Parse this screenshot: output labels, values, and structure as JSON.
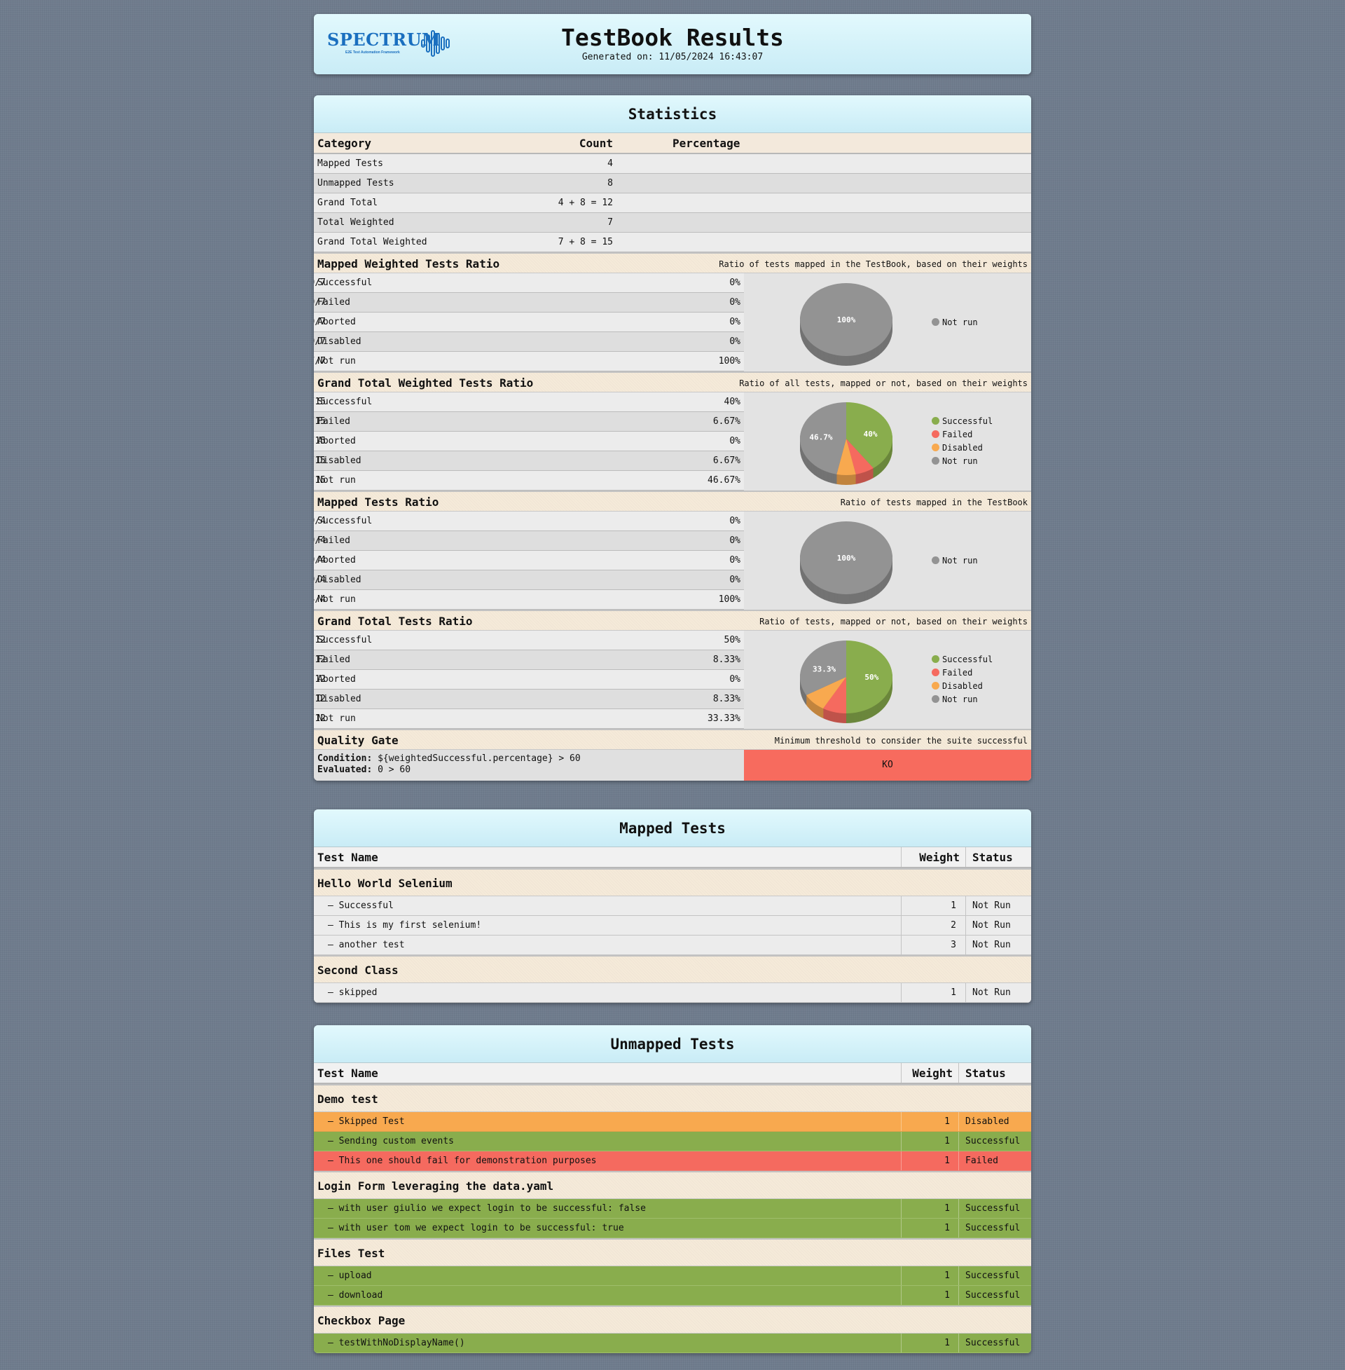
{
  "header": {
    "logo": "SPECTRUM",
    "logo_sub": "E2E Test Automation Framework",
    "title": "TestBook Results",
    "generated": "Generated on: 11/05/2024 16:43:07"
  },
  "statistics": {
    "title": "Statistics",
    "columns": [
      "Category",
      "Count",
      "Percentage"
    ],
    "summary": [
      {
        "category": "Mapped Tests",
        "count": "4"
      },
      {
        "category": "Unmapped Tests",
        "count": "8"
      },
      {
        "category": "Grand Total",
        "count": "4 + 8 = 12"
      },
      {
        "category": "Total Weighted",
        "count": "7"
      },
      {
        "category": "Grand Total Weighted",
        "count": "7 + 8 = 15"
      }
    ],
    "ratios": [
      {
        "title": "Mapped Weighted Tests Ratio",
        "desc": "Ratio of tests mapped in the TestBook, based on their weights",
        "rows": [
          {
            "label": "Successful",
            "count": "0/7",
            "pct": "0%"
          },
          {
            "label": "Failed",
            "count": "0/7",
            "pct": "0%"
          },
          {
            "label": "Aborted",
            "count": "0/7",
            "pct": "0%"
          },
          {
            "label": "Disabled",
            "count": "0/7",
            "pct": "0%"
          },
          {
            "label": "Not run",
            "count": "7/7",
            "pct": "100%"
          }
        ],
        "slices": [
          {
            "name": "Not run",
            "value": 100,
            "color": "#939393",
            "label": "100%"
          }
        ],
        "legend": [
          "Not run"
        ]
      },
      {
        "title": "Grand Total Weighted Tests Ratio",
        "desc": "Ratio of all tests, mapped or not, based on their weights",
        "rows": [
          {
            "label": "Successful",
            "count": "6/15",
            "pct": "40%"
          },
          {
            "label": "Failed",
            "count": "1/15",
            "pct": "6.67%"
          },
          {
            "label": "Aborted",
            "count": "0/15",
            "pct": "0%"
          },
          {
            "label": "Disabled",
            "count": "1/15",
            "pct": "6.67%"
          },
          {
            "label": "Not run",
            "count": "7/15",
            "pct": "46.67%"
          }
        ],
        "slices": [
          {
            "name": "Successful",
            "value": 40,
            "color": "#89ad4d",
            "label": "40%"
          },
          {
            "name": "Failed",
            "value": 6.67,
            "color": "#f56a5f",
            "label": ""
          },
          {
            "name": "Disabled",
            "value": 6.67,
            "color": "#f8a94f",
            "label": ""
          },
          {
            "name": "Not run",
            "value": 46.67,
            "color": "#939393",
            "label": "46.7%"
          }
        ],
        "legend": [
          "Successful",
          "Failed",
          "Disabled",
          "Not run"
        ]
      },
      {
        "title": "Mapped Tests Ratio",
        "desc": "Ratio of tests mapped in the TestBook",
        "rows": [
          {
            "label": "Successful",
            "count": "0/4",
            "pct": "0%"
          },
          {
            "label": "Failed",
            "count": "0/4",
            "pct": "0%"
          },
          {
            "label": "Aborted",
            "count": "0/4",
            "pct": "0%"
          },
          {
            "label": "Disabled",
            "count": "0/4",
            "pct": "0%"
          },
          {
            "label": "Not run",
            "count": "4/4",
            "pct": "100%"
          }
        ],
        "slices": [
          {
            "name": "Not run",
            "value": 100,
            "color": "#939393",
            "label": "100%"
          }
        ],
        "legend": [
          "Not run"
        ]
      },
      {
        "title": "Grand Total Tests Ratio",
        "desc": "Ratio of tests, mapped or not, based on their weights",
        "rows": [
          {
            "label": "Successful",
            "count": "6/12",
            "pct": "50%"
          },
          {
            "label": "Failed",
            "count": "1/12",
            "pct": "8.33%"
          },
          {
            "label": "Aborted",
            "count": "0/12",
            "pct": "0%"
          },
          {
            "label": "Disabled",
            "count": "1/12",
            "pct": "8.33%"
          },
          {
            "label": "Not run",
            "count": "4/12",
            "pct": "33.33%"
          }
        ],
        "slices": [
          {
            "name": "Successful",
            "value": 50,
            "color": "#89ad4d",
            "label": "50%"
          },
          {
            "name": "Failed",
            "value": 8.33,
            "color": "#f56a5f",
            "label": ""
          },
          {
            "name": "Disabled",
            "value": 8.33,
            "color": "#f8a94f",
            "label": ""
          },
          {
            "name": "Not run",
            "value": 33.33,
            "color": "#939393",
            "label": "33.3%"
          }
        ],
        "legend": [
          "Successful",
          "Failed",
          "Disabled",
          "Not run"
        ]
      }
    ],
    "legend_colors": {
      "Successful": "#89ad4d",
      "Failed": "#f56a5f",
      "Disabled": "#f8a94f",
      "Not run": "#939393"
    },
    "quality_gate": {
      "title": "Quality Gate",
      "desc": "Minimum threshold to consider the suite successful",
      "condition_label": "Condition:",
      "condition": "${weightedSuccessful.percentage} > 60",
      "evaluated_label": "Evaluated:",
      "evaluated": "0 > 60",
      "result": "KO"
    }
  },
  "mapped": {
    "title": "Mapped Tests",
    "columns": [
      "Test Name",
      "Weight",
      "Status"
    ],
    "groups": [
      {
        "name": "Hello World Selenium",
        "tests": [
          {
            "name": "– Successful",
            "weight": "1",
            "status": "Not Run"
          },
          {
            "name": "– This is my first selenium!",
            "weight": "2",
            "status": "Not Run"
          },
          {
            "name": "– another test",
            "weight": "3",
            "status": "Not Run"
          }
        ]
      },
      {
        "name": "Second Class",
        "tests": [
          {
            "name": "– skipped",
            "weight": "1",
            "status": "Not Run"
          }
        ]
      }
    ]
  },
  "unmapped": {
    "title": "Unmapped Tests",
    "columns": [
      "Test Name",
      "Weight",
      "Status"
    ],
    "groups": [
      {
        "name": "Demo test",
        "tests": [
          {
            "name": "– Skipped Test",
            "weight": "1",
            "status": "Disabled"
          },
          {
            "name": "– Sending custom events",
            "weight": "1",
            "status": "Successful"
          },
          {
            "name": "– This one should fail for demonstration purposes",
            "weight": "1",
            "status": "Failed"
          }
        ]
      },
      {
        "name": "Login Form leveraging the data.yaml",
        "tests": [
          {
            "name": "– with user giulio we expect login to be successful: false",
            "weight": "1",
            "status": "Successful"
          },
          {
            "name": "– with user tom we expect login to be successful: true",
            "weight": "1",
            "status": "Successful"
          }
        ]
      },
      {
        "name": "Files Test",
        "tests": [
          {
            "name": "– upload",
            "weight": "1",
            "status": "Successful"
          },
          {
            "name": "– download",
            "weight": "1",
            "status": "Successful"
          }
        ]
      },
      {
        "name": "Checkbox Page",
        "tests": [
          {
            "name": "– testWithNoDisplayName()",
            "weight": "1",
            "status": "Successful"
          }
        ]
      }
    ]
  }
}
